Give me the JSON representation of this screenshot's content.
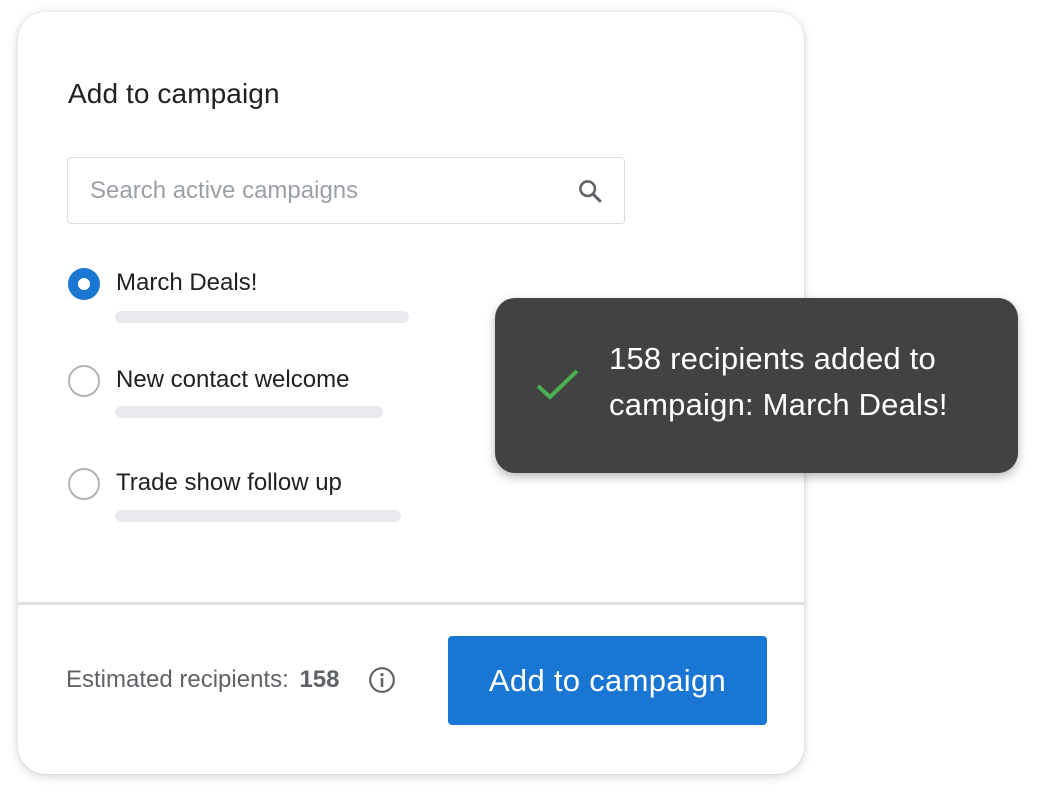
{
  "dialog": {
    "title": "Add to campaign",
    "search": {
      "placeholder": "Search active campaigns",
      "value": "",
      "icon": "search-icon"
    },
    "campaigns": [
      {
        "label": "March Deals!",
        "selected": true
      },
      {
        "label": "New contact welcome",
        "selected": false
      },
      {
        "label": "Trade show follow up",
        "selected": false
      }
    ],
    "footer": {
      "recipients_label": "Estimated recipients:",
      "recipients_count": "158",
      "info_icon": "info-icon",
      "submit_label": "Add to campaign"
    }
  },
  "toast": {
    "icon": "check-icon",
    "message": "158 recipients added to campaign: March Deals!"
  },
  "colors": {
    "primary": "#1976d2",
    "toast_background": "#424242",
    "success_check": "#4caf50",
    "placeholder_bar": "#e8eaed"
  }
}
